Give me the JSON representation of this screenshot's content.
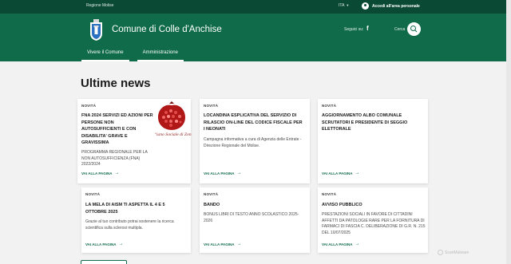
{
  "topbar": {
    "region": "Regione Molise",
    "language": "ITA",
    "login": "Accedi all'area personale"
  },
  "header": {
    "title": "Comune di Colle d'Anchise",
    "social_label": "Seguici su:",
    "search_label": "Cerca",
    "nav": [
      "Vivere il Comune",
      "Amministrazione"
    ]
  },
  "main": {
    "heading": "Ultime news",
    "cards": [
      {
        "category": "NOVITÀ",
        "title": "FNA 2024   SERVIZI ED AZIONI PER PERSONE NON AUTOSUFFICIENTI E CON DISABILITA' GRAVE E GRAVISSIMA",
        "text": "PROGRAMMA REGIONALE PER LA NON AUTOSUFFICIENZA (FNA) 2022/2024",
        "link": "VAI ALLA PAGINA",
        "image_caption": "\"iano Sociale di Zon"
      },
      {
        "category": "NOVITÀ",
        "title": "LOCANDINA ESPLICATIVA DEL SERVIZIO DI RILASCIO ON-LINE DEL CODICE FISCALE PER I NEONATI",
        "text": "Campagna informativa a cura di Agenzia delle Entrate - Direzione Regionale del Molise.",
        "link": "VAI ALLA PAGINA"
      },
      {
        "category": "NOVITÀ",
        "title": "AGGIORNAMENTO ALBO COMUNALE SCRUTATORI E PRESIDENTE DI SEGGIO ELETTORALE",
        "text": "",
        "link": "VAI ALLA PAGINA"
      },
      {
        "category": "NOVITÀ",
        "title": "LA MELA DI AISM TI ASPETTA IL 4 E 5 OTTOBRE 2025",
        "text": "Grazie al tuo contributo potrai sostenere la ricerca scientifica sulla sclerosi multipla.",
        "link": "VAI ALLA PAGINA"
      },
      {
        "category": "NOVITÀ",
        "title": "BANDO",
        "text": "BONUS LIBRI DI TESTO ANNO SCOLASTICO 2025-2026",
        "link": "VAI ALLA PAGINA"
      },
      {
        "category": "NOVITÀ",
        "title": "AVVISO PUBBLICO",
        "text": "PRESTAZIONI SOCIALI IN FAVORE DI CITTADINI AFFETTI DA PATOLOGIE RARE PER LA FORNITURA DI FARMACI DI FASCIA C.  DELIBERAZIONE DI G.R. N. 215 DEL 10/07/2025",
        "link": "VAI ALLA PAGINA"
      }
    ]
  },
  "watermark": "ScanMalware",
  "colors": {
    "header_green": "#0f6b49",
    "topbar_green": "#0a4a34",
    "link_green": "#0f6b49"
  }
}
